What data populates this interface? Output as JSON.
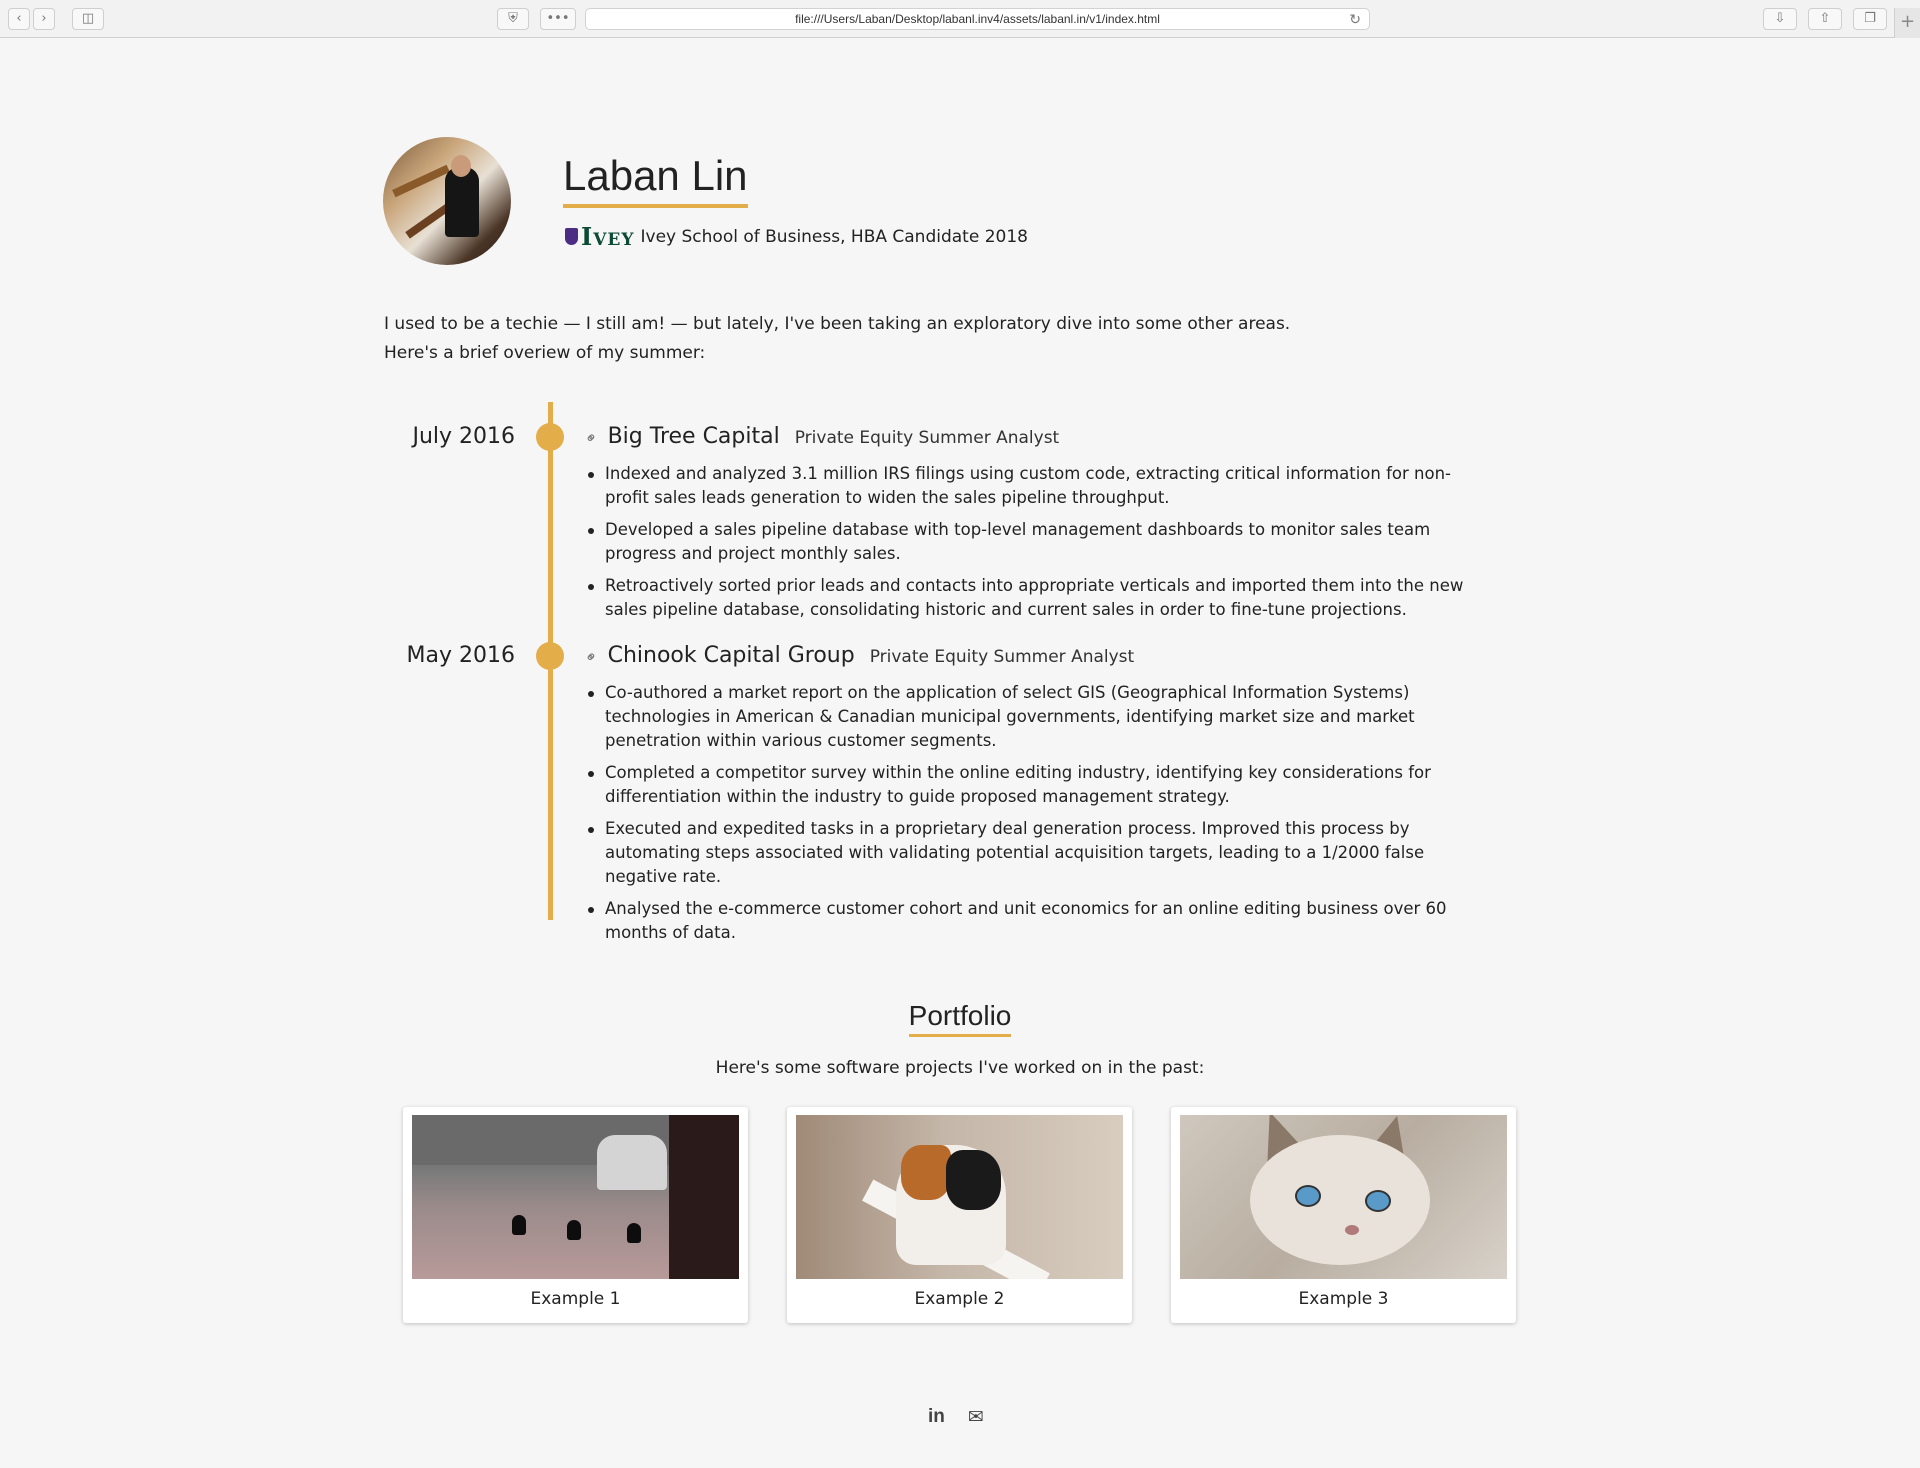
{
  "browser": {
    "url": "file:///Users/Laban/Desktop/labanl.inv4/assets/labanl.in/v1/index.html"
  },
  "header": {
    "name": "Laban Lin",
    "logo_text": "Ivey",
    "school": "Ivey School of Business, HBA Candidate 2018"
  },
  "intro": {
    "line1": "I used to be a techie — I still am! — but lately, I've been taking an exploratory dive into some other areas.",
    "line2": "Here's a brief overiew of my summer:"
  },
  "timeline": [
    {
      "date": "July 2016",
      "company": "Big Tree Capital",
      "role": "Private Equity Summer Analyst",
      "bullets": [
        "Indexed and analyzed 3.1 million IRS filings using custom code, extracting critical information for non-profit sales leads generation to widen the sales pipeline throughput.",
        "Developed a sales pipeline database with top-level management dashboards to monitor sales team progress and project monthly sales.",
        "Retroactively sorted prior leads and contacts into appropriate verticals and imported them into the new sales pipeline database, consolidating historic and current sales in order to fine-tune projections."
      ]
    },
    {
      "date": "May 2016",
      "company": "Chinook Capital Group",
      "role": "Private Equity Summer Analyst",
      "bullets": [
        "Co-authored a market report on the application of select GIS (Geographical Information Systems) technologies in American & Canadian municipal governments, identifying market size and market penetration within various customer segments.",
        "Completed a competitor survey within the online editing industry, identifying key considerations for differentiation within the industry to guide proposed management strategy.",
        "Executed and expedited tasks in a proprietary deal generation process. Improved this process by automating steps associated with validating potential acquisition targets, leading to a 1/2000 false negative rate.",
        "Analysed the e-commerce customer cohort and unit economics for an online editing business over 60 months of data."
      ]
    }
  ],
  "portfolio": {
    "title": "Portfolio",
    "subtitle": "Here's some software projects I've worked on in the past:",
    "items": [
      {
        "caption": "Example 1"
      },
      {
        "caption": "Example 2"
      },
      {
        "caption": "Example 3"
      }
    ]
  },
  "footer": {
    "linkedin": "in",
    "icons": [
      "linkedin-icon",
      "email-icon"
    ]
  },
  "colors": {
    "accent": "#e3ad4a",
    "ivey_green": "#0c4a36"
  }
}
